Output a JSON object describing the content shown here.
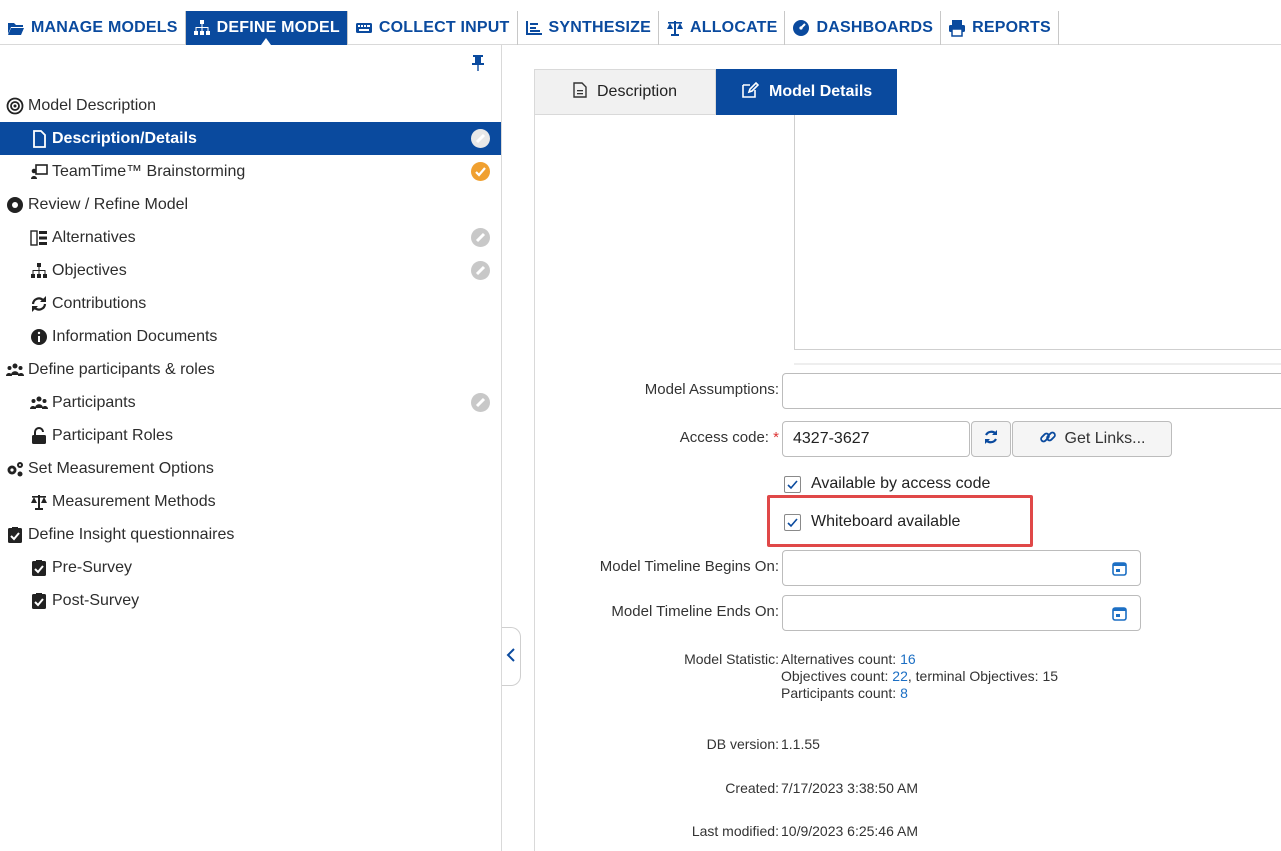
{
  "nav": {
    "items": [
      {
        "label": "MANAGE MODELS",
        "icon": "folder-open-icon"
      },
      {
        "label": "DEFINE MODEL",
        "icon": "sitemap-icon",
        "active": true
      },
      {
        "label": "COLLECT INPUT",
        "icon": "keyboard-icon"
      },
      {
        "label": "SYNTHESIZE",
        "icon": "bar-chart-icon"
      },
      {
        "label": "ALLOCATE",
        "icon": "balance-scale-icon"
      },
      {
        "label": "DASHBOARDS",
        "icon": "gauge-icon"
      },
      {
        "label": "REPORTS",
        "icon": "print-icon"
      }
    ]
  },
  "sidebar": {
    "items": [
      {
        "label": "Model Description",
        "level": 0,
        "icon": "bullseye-icon"
      },
      {
        "label": "Description/Details",
        "level": 1,
        "icon": "file-icon",
        "selected": true,
        "status": "white"
      },
      {
        "label": "TeamTime™ Brainstorming",
        "level": 1,
        "icon": "presentation-icon",
        "status": "orange"
      },
      {
        "label": "Review / Refine Model",
        "level": 0,
        "icon": "circle-icon"
      },
      {
        "label": "Alternatives",
        "level": 1,
        "icon": "list-icon",
        "status": "gray"
      },
      {
        "label": "Objectives",
        "level": 1,
        "icon": "sitemap-icon",
        "status": "gray"
      },
      {
        "label": "Contributions",
        "level": 1,
        "icon": "sync-icon"
      },
      {
        "label": "Information Documents",
        "level": 1,
        "icon": "info-icon"
      },
      {
        "label": "Define participants & roles",
        "level": 0,
        "icon": "users-icon"
      },
      {
        "label": "Participants",
        "level": 1,
        "icon": "users-icon",
        "status": "gray"
      },
      {
        "label": "Participant Roles",
        "level": 1,
        "icon": "unlock-icon"
      },
      {
        "label": "Set Measurement Options",
        "level": 0,
        "icon": "cogs-icon"
      },
      {
        "label": "Measurement Methods",
        "level": 1,
        "icon": "balance-scale-icon"
      },
      {
        "label": "Define Insight questionnaires",
        "level": 0,
        "icon": "clipboard-check-icon"
      },
      {
        "label": "Pre-Survey",
        "level": 1,
        "icon": "clipboard-check-icon"
      },
      {
        "label": "Post-Survey",
        "level": 1,
        "icon": "clipboard-check-icon"
      }
    ]
  },
  "tabs": [
    {
      "label": "Description",
      "icon": "file-text-icon"
    },
    {
      "label": "Model Details",
      "icon": "edit-icon",
      "active": true
    }
  ],
  "form": {
    "assumptions_label": "Model Assumptions:",
    "assumptions_value": "",
    "access_code_label": "Access code:",
    "required_mark": "*",
    "access_code_value": "4327-3627",
    "get_links_label": "Get Links...",
    "available_by_code_label": "Available by access code",
    "available_by_code_checked": true,
    "whiteboard_label": "Whiteboard available",
    "whiteboard_checked": true,
    "timeline_begins_label": "Model Timeline Begins On:",
    "timeline_begins_value": "",
    "timeline_ends_label": "Model Timeline Ends On:",
    "timeline_ends_value": "",
    "statistic_label": "Model Statistic:",
    "alternatives_text": "Alternatives count:",
    "alternatives_count": "16",
    "objectives_text": "Objectives count:",
    "objectives_count": "22",
    "terminal_text": ", terminal Objectives: 15",
    "participants_text": "Participants count:",
    "participants_count": "8",
    "db_version_label": "DB version:",
    "db_version_value": "1.1.55",
    "created_label": "Created:",
    "created_value": "7/17/2023 3:38:50 AM",
    "modified_label": "Last modified:",
    "modified_value": "10/9/2023 6:25:46 AM"
  },
  "colors": {
    "accent": "#0a4a9e",
    "highlight": "#e04848",
    "link": "#1c6fc4",
    "status_orange": "#f0a030"
  }
}
